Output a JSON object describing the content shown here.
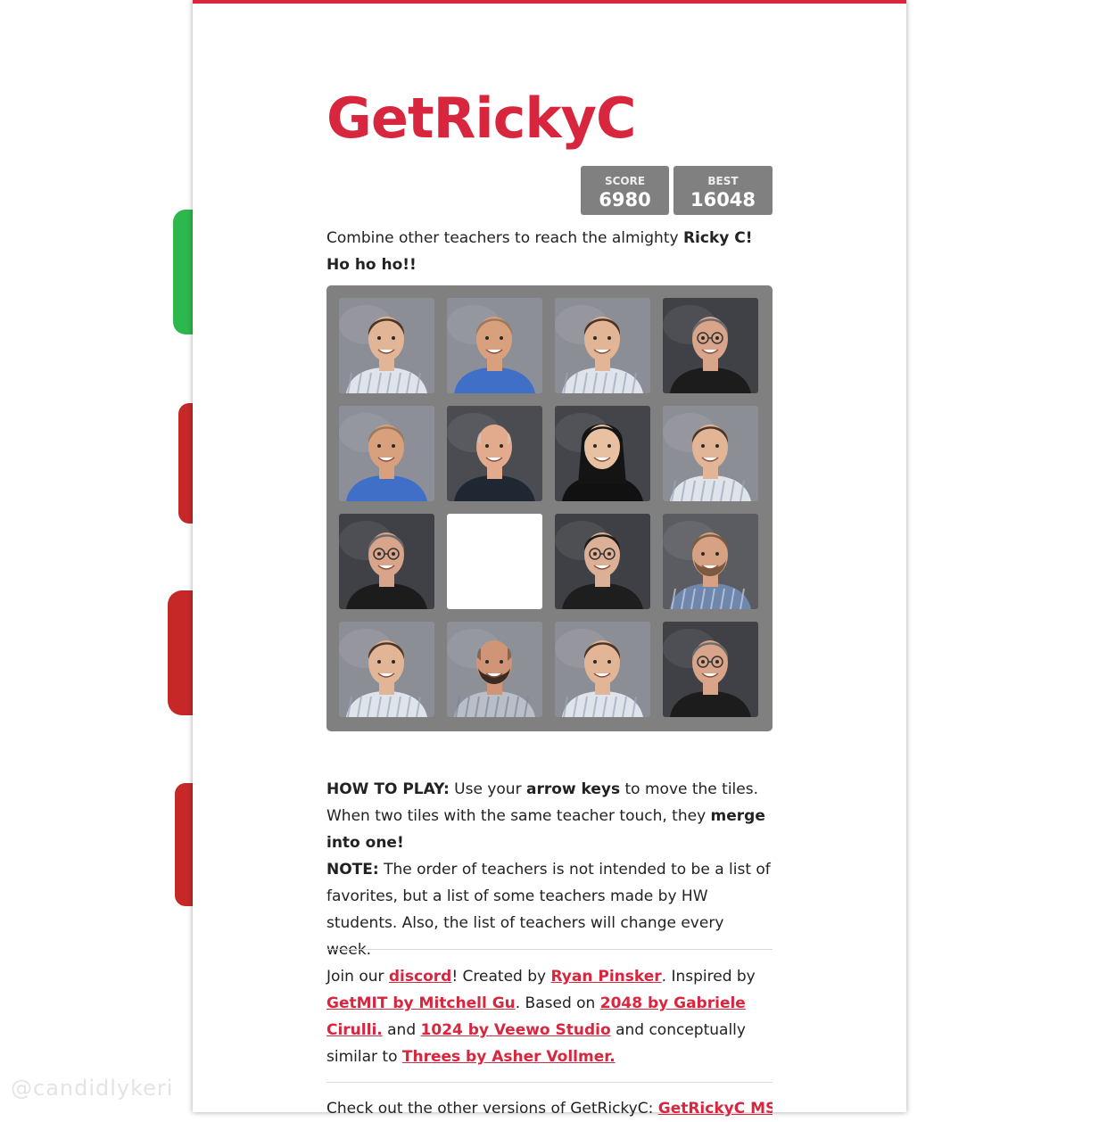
{
  "watermark": "@candidlykeri",
  "title": "GetRickyC",
  "score": {
    "label": "SCORE",
    "value": "6980"
  },
  "best": {
    "label": "BEST",
    "value": "16048"
  },
  "intro": {
    "text": "Combine other teachers to reach the almighty ",
    "bold": "Ricky C! Ho ho ho!!"
  },
  "grid": {
    "size": 4,
    "tiles": [
      [
        "teacher-a",
        "teacher-b",
        "teacher-a",
        "teacher-c"
      ],
      [
        "teacher-b",
        "teacher-d",
        "teacher-e",
        "teacher-a"
      ],
      [
        "teacher-c",
        "empty",
        "teacher-f",
        "teacher-g"
      ],
      [
        "teacher-a",
        "teacher-h",
        "teacher-a",
        "teacher-c"
      ]
    ],
    "colors": {
      "board": "#808080",
      "accent": "#d7263d",
      "studio_bg": "#8d8f97"
    }
  },
  "howto": {
    "label": "HOW TO PLAY:",
    "t1": " Use your ",
    "b1": "arrow keys",
    "t2": " to move the tiles. When two tiles with the same teacher touch, they ",
    "b2": "merge into one!",
    "note_label": "NOTE:",
    "note_text": " The order of teachers is not intended to be a list of favorites, but a list of some teachers made by HW students. Also, the list of teachers will change every week."
  },
  "credits": {
    "t1": "Join our ",
    "discord": "discord",
    "t2": "! Created by ",
    "creator": "Ryan Pinsker",
    "t3": ". Inspired by ",
    "getmit": "GetMIT by Mitchell Gu",
    "t4": ". Based on ",
    "l2048": "2048 by Gabriele Cirulli.",
    "t5": " and ",
    "l1024": "1024 by Veewo Studio",
    "t6": " and conceptually similar to ",
    "threes": "Threes by Asher Vollmer."
  },
  "more": {
    "text": "Check out the other versions of GetRickyC: ",
    "link": "GetRickyC MS"
  }
}
